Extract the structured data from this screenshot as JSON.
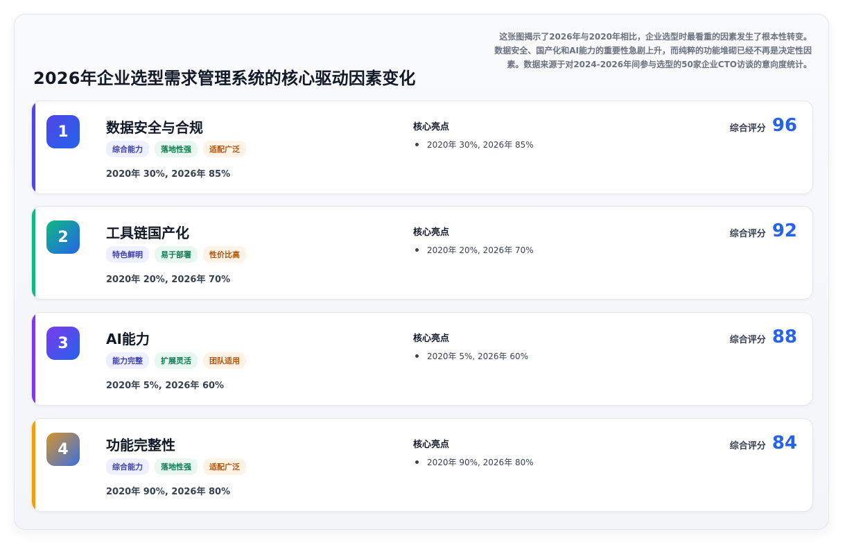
{
  "header": {
    "title": "2026年企业选型需求管理系统的核心驱动因素变化",
    "description": "这张图揭示了2026年与2020年相比，企业选型时最看重的因素发生了根本性转变。数据安全、国产化和AI能力的重要性急剧上升，而纯粹的功能堆砌已经不再是决定性因素。数据来源于对2024-2026年间参与选型的50家企业CTO访谈的意向度统计。"
  },
  "highlight_heading": "核心亮点",
  "score_label": "综合评分",
  "colors": {
    "accent_1": "#5046e5",
    "accent_2": "#10b981",
    "accent_3": "#7c3aed",
    "accent_4": "#f59e0b",
    "score": "#2563eb"
  },
  "cards": [
    {
      "rank": "1",
      "title": "数据安全与合规",
      "tags": [
        "综合能力",
        "落地性强",
        "适配广泛"
      ],
      "stat": "2020年 30%, 2026年 85%",
      "highlight": "2020年 30%, 2026年 85%",
      "score": "96"
    },
    {
      "rank": "2",
      "title": "工具链国产化",
      "tags": [
        "特色鲜明",
        "易于部署",
        "性价比高"
      ],
      "stat": "2020年 20%, 2026年 70%",
      "highlight": "2020年 20%, 2026年 70%",
      "score": "92"
    },
    {
      "rank": "3",
      "title": "AI能力",
      "tags": [
        "能力完整",
        "扩展灵活",
        "团队适用"
      ],
      "stat": "2020年 5%, 2026年 60%",
      "highlight": "2020年 5%, 2026年 60%",
      "score": "88"
    },
    {
      "rank": "4",
      "title": "功能完整性",
      "tags": [
        "综合能力",
        "落地性强",
        "适配广泛"
      ],
      "stat": "2020年 90%, 2026年 80%",
      "highlight": "2020年 90%, 2026年 80%",
      "score": "84"
    }
  ]
}
